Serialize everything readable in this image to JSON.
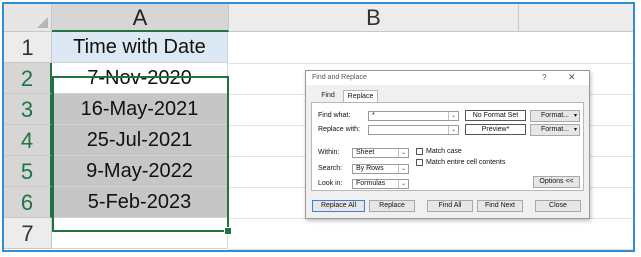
{
  "sheet": {
    "columns": [
      {
        "label": "A"
      },
      {
        "label": "B"
      }
    ],
    "rows": [
      {
        "num": "1",
        "value": "Time with Date"
      },
      {
        "num": "2",
        "value": "7-Nov-2020"
      },
      {
        "num": "3",
        "value": "16-May-2021"
      },
      {
        "num": "4",
        "value": "25-Jul-2021"
      },
      {
        "num": "5",
        "value": "9-May-2022"
      },
      {
        "num": "6",
        "value": "5-Feb-2023"
      },
      {
        "num": "7",
        "value": ""
      }
    ],
    "accent": "#217346",
    "header_fill": "#dce9f5",
    "selection_fill": "#c6c6c6"
  },
  "dialog": {
    "title": "Find and Replace",
    "help": "?",
    "close": "✕",
    "tabs": {
      "find": "Find",
      "replace": "Replace"
    },
    "find_label": "Find what:",
    "find_value": "*",
    "replace_label": "Replace with:",
    "replace_value": "",
    "find_format_status": "No Format Set",
    "replace_format_status": "Preview*",
    "format_button": "Format...",
    "within_label": "Within:",
    "within_value": "Sheet",
    "search_label": "Search:",
    "search_value": "By Rows",
    "lookin_label": "Look in:",
    "lookin_value": "Formulas",
    "match_case": "Match case",
    "match_entire": "Match entire cell contents",
    "options_button": "Options <<",
    "buttons": {
      "replace_all": "Replace All",
      "replace": "Replace",
      "find_all": "Find All",
      "find_next": "Find Next",
      "close": "Close"
    }
  }
}
